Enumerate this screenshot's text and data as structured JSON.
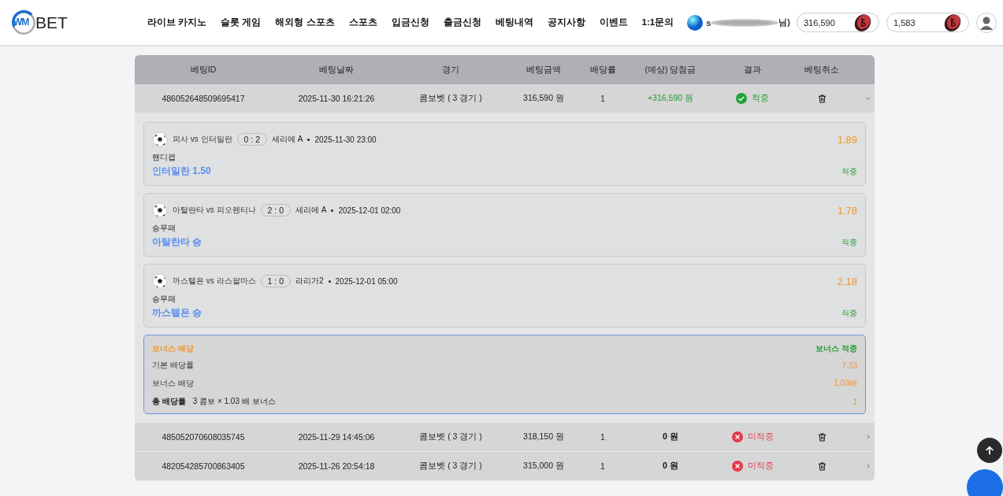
{
  "logo": {
    "mark": "WM",
    "text": "BET"
  },
  "nav": [
    "라이브 카지노",
    "슬롯 게임",
    "해외형 스포츠",
    "스포츠",
    "입금신청",
    "출금신청",
    "베팅내역",
    "공지사항",
    "이벤트",
    "1:1문의"
  ],
  "user": {
    "name_start": "s",
    "name_end": "님)"
  },
  "balances": [
    {
      "amount": "316,590"
    },
    {
      "amount": "1,583"
    }
  ],
  "table": {
    "columns": [
      "베팅ID",
      "베팅날짜",
      "경기",
      "베팅금액",
      "배당률",
      "(예상) 당첨금",
      "결과",
      "베팅취소"
    ],
    "rows": [
      {
        "id": "486052648509695417",
        "date": "2025-11-30 16:21:26",
        "game": "콤보벳 ( 3 경기 )",
        "amount": "316,590 원",
        "odds": "1",
        "payout": {
          "text": "+316,590 원",
          "kind": "gain"
        },
        "result": {
          "kind": "win",
          "label": "적중"
        },
        "expanded": true,
        "selections": [
          {
            "match": "피사 vs 인터밀란",
            "score": "0 : 2",
            "league": "세리에 A",
            "time": "2025-11-30 23:00",
            "market": "핸디캡",
            "pick": "인터밀란 1.50",
            "odds": "1.89",
            "status": "적중"
          },
          {
            "match": "아탈란타 vs 피오렌티나",
            "score": "2 : 0",
            "league": "세리에 A",
            "time": "2025-12-01 02:00",
            "market": "승무패",
            "pick": "아탈란타 승",
            "odds": "1.78",
            "status": "적중"
          },
          {
            "match": "까스텔욘 vs 라스팔마스",
            "score": "1 : 0",
            "league": "라리가2",
            "time": "2025-12-01 05:00",
            "market": "승무패",
            "pick": "까스텔욘 승",
            "odds": "2.18",
            "status": "적중"
          }
        ],
        "bonus": {
          "title": "보너스 배당",
          "status": "보너스 적중",
          "lines": [
            {
              "label": "기본 배당률",
              "value": "7.33"
            },
            {
              "label": "보너스 배당",
              "value": "1.03배"
            }
          ],
          "total": {
            "label": "총 배당률",
            "detail": "3 콤보 × 1.03 배 보너스",
            "value": "1"
          }
        }
      },
      {
        "id": "485052070608035745",
        "date": "2025-11-29 14:45:06",
        "game": "콤보벳 ( 3 경기 )",
        "amount": "318,150 원",
        "odds": "1",
        "payout": {
          "text": "0 원",
          "kind": "zero"
        },
        "result": {
          "kind": "lose",
          "label": "미적중"
        },
        "expanded": false
      },
      {
        "id": "482054285700863405",
        "date": "2025-11-26 20:54:18",
        "game": "콤보벳 ( 3 경기 )",
        "amount": "315,000 원",
        "odds": "1",
        "payout": {
          "text": "0 원",
          "kind": "zero"
        },
        "result": {
          "kind": "lose",
          "label": "미적중"
        },
        "expanded": false
      }
    ]
  }
}
